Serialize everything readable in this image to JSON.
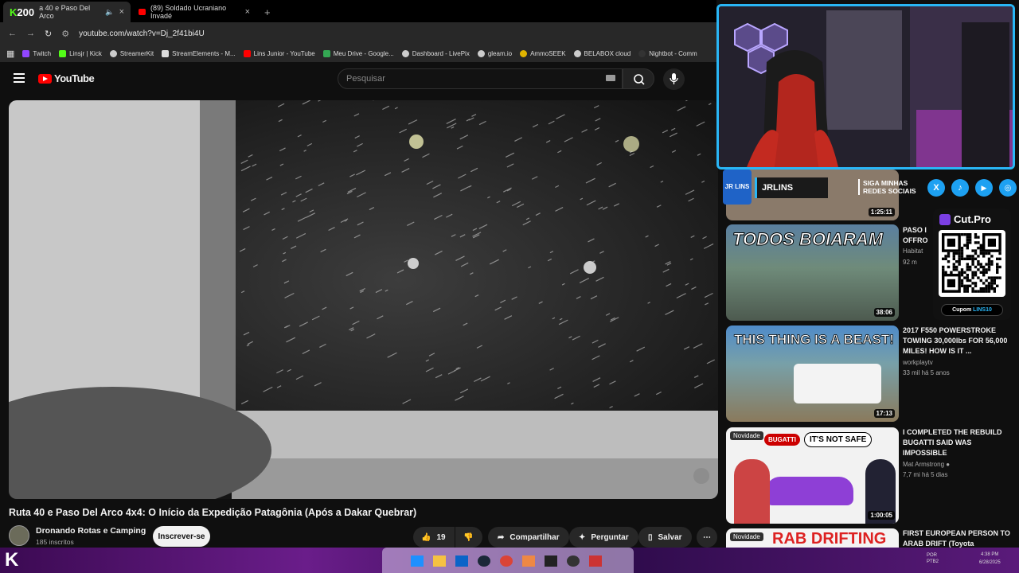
{
  "colors": {
    "accent_red": "#ff0000",
    "kick_green": "#53fc18",
    "overlay_blue": "#29b6f6"
  },
  "tabs": [
    {
      "label": "a 40 e Paso Del Arco",
      "badge": "200",
      "active": true,
      "icon": "kick-icon"
    },
    {
      "label": "(89) Soldado Ucraniano Invadé",
      "active": false,
      "icon": "youtube-icon"
    }
  ],
  "address": {
    "url": "youtube.com/watch?v=Dj_2f41bi4U"
  },
  "bookmarks": [
    {
      "label": "Twitch",
      "color": "#9146ff"
    },
    {
      "label": "Linsjr | Kick",
      "color": "#53fc18"
    },
    {
      "label": "StreamerKit",
      "color": "#cccccc"
    },
    {
      "label": "StreamElements - M...",
      "color": "#dddddd"
    },
    {
      "label": "Lins Junior - YouTube",
      "color": "#ff0000"
    },
    {
      "label": "Meu Drive - Google...",
      "color": "#34a853"
    },
    {
      "label": "Dashboard - LivePix",
      "color": "#cccccc"
    },
    {
      "label": "gleam.io",
      "color": "#cccccc"
    },
    {
      "label": "AmmoSEEK",
      "color": "#e0b400"
    },
    {
      "label": "BELABOX cloud",
      "color": "#cccccc"
    },
    {
      "label": "Nightbot - Comm",
      "color": "#333333"
    }
  ],
  "youtube": {
    "logo": "YouTube",
    "search_placeholder": "Pesquisar"
  },
  "video": {
    "title": "Ruta 40 e Paso Del Arco 4x4: O Início da Expedição Patagônia (Após a Dakar Quebrar)",
    "channel": "Dronando Rotas e Camping",
    "subscribers": "185 inscritos",
    "subscribe_label": "Inscrever-se",
    "likes": "19",
    "share_label": "Compartilhar",
    "ask_label": "Perguntar",
    "save_label": "Salvar"
  },
  "recommendations": [
    {
      "duration": "1:25:11",
      "title": "",
      "channel": "",
      "meta": ""
    },
    {
      "duration": "38:06",
      "thumb_text": "TODOS BOIARAM",
      "title": "PASO I\nOFFRO",
      "channel": "Habitat",
      "meta": "92 m"
    },
    {
      "duration": "17:13",
      "thumb_text": "THIS THING IS A BEAST!",
      "title": "2017 F550 POWERSTROKE TOWING 30,000lbs FOR 56,000 MILES! HOW IS IT ...",
      "channel": "workplaytv",
      "meta": "33 mil  há 5 anos"
    },
    {
      "duration": "1:00:05",
      "badge": "Novidade",
      "thumb_text": "IT'S NOT SAFE",
      "thumb_brand": "BUGATTI",
      "title": "I COMPLETED THE REBUILD BUGATTI SAID WAS IMPOSSIBLE",
      "channel": "Mat Armstrong",
      "meta": "7,7 mi  há 5 dias"
    },
    {
      "badge": "Novidade",
      "thumb_text": "RAB DRIFTING",
      "title": "FIRST EUROPEAN PERSON TO ARAB DRIFT (Toyota",
      "channel": "",
      "meta": ""
    }
  ],
  "overlay": {
    "logo_text": "JR LINS",
    "name": "JRLINS",
    "socials_line1": "SIGA MINHAS",
    "socials_line2": "REDES SOCIAIS",
    "cutpro": "Cut.Pro",
    "cupom_label": "Cupom",
    "cupom_code": "LINS10"
  },
  "taskbar": {
    "time": "4:38 PM",
    "date": "6/28/2025",
    "lang": "POR\nPTB2"
  }
}
